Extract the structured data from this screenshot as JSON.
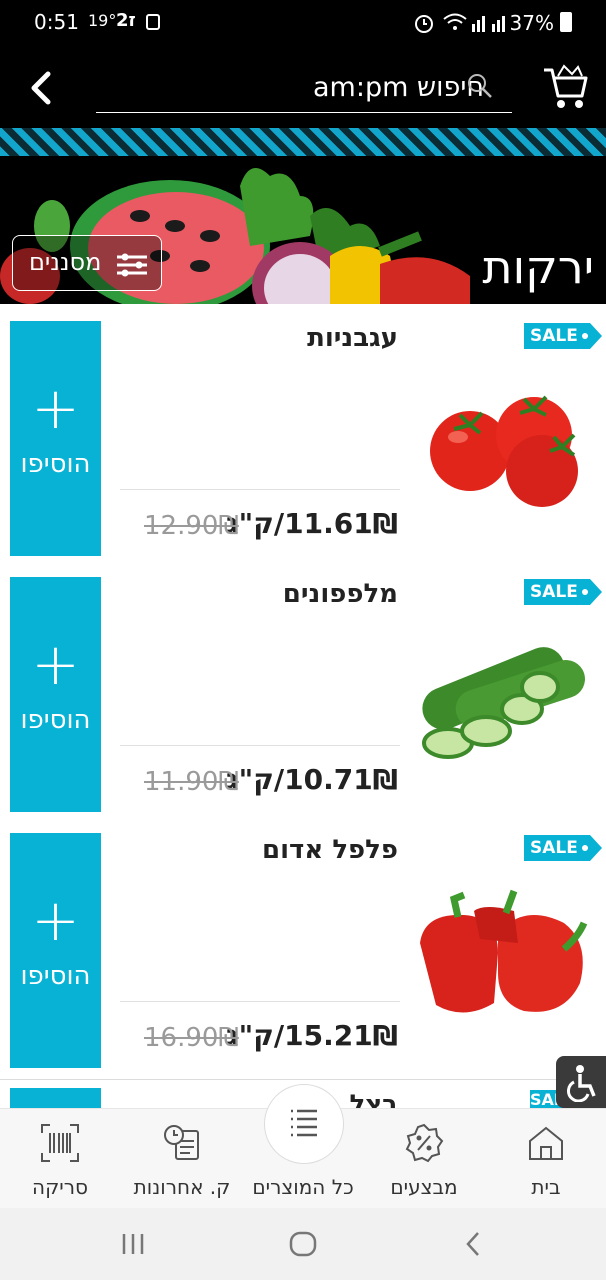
{
  "status_bar": {
    "time": "0:51",
    "temperature": "19°",
    "battery": "37%"
  },
  "header": {
    "search_placeholder": "חיפוש am:pm"
  },
  "banner": {
    "title": "ירקות",
    "filters_label": "מסננים"
  },
  "products": [
    {
      "name": "עגבניות",
      "price": "11.61₪/ק\"ג",
      "old_price": "12.90₪",
      "sale": "SALE",
      "add_label": "הוסיפו",
      "add_symbol": "+"
    },
    {
      "name": "מלפפונים",
      "price": "10.71₪/ק\"ג",
      "old_price": "11.90₪",
      "sale": "SALE",
      "add_label": "הוסיפו",
      "add_symbol": "+"
    },
    {
      "name": "פלפל אדום",
      "price": "15.21₪/ק\"ג",
      "old_price": "16.90₪",
      "sale": "SALE",
      "add_label": "הוסיפו",
      "add_symbol": "+"
    }
  ],
  "partial_product": {
    "name_fragment": "בצל",
    "sale": "SALE"
  },
  "bottom_nav": {
    "items": [
      {
        "label": "סריקה",
        "icon": "barcode-scan-icon"
      },
      {
        "label": "ק. אחרונות",
        "icon": "recent-orders-icon"
      },
      {
        "label": "כל המוצרים",
        "icon": "list-icon"
      },
      {
        "label": "מבצעים",
        "icon": "percent-badge-icon"
      },
      {
        "label": "בית",
        "icon": "home-icon"
      }
    ]
  },
  "colors": {
    "accent": "#07b2d4",
    "header_bg": "#000000"
  }
}
